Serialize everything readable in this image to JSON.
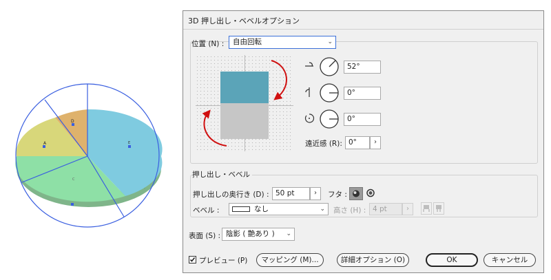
{
  "dialog": {
    "title": "3D 押し出し・ベベルオプション",
    "position_label": "位置 (N) :",
    "position_value": "自由回転",
    "rotation_x": "52°",
    "rotation_y": "0°",
    "rotation_z": "0°",
    "perspective_label": "遠近感 (R):",
    "perspective_value": "0°",
    "extrude_section_label": "押し出し・ベベル",
    "depth_label": "押し出しの奥行き (D) :",
    "depth_value": "50 pt",
    "cap_label": "フタ :",
    "bevel_label": "ベベル :",
    "bevel_value": "なし",
    "height_label": "高さ (H) :",
    "height_value": "4 pt",
    "surface_label": "表面 (S) :",
    "surface_value": "陰影 ( 艶あり )",
    "preview_label": "プレビュー (P)",
    "preview_checked": true,
    "mapping_button": "マッピング (M)...",
    "more_options_button": "詳細オプション (O)",
    "ok_button": "OK",
    "cancel_button": "キャンセル"
  },
  "pie": {
    "labels": [
      "A",
      "D",
      "C",
      "E"
    ],
    "colors": {
      "blue": "#7fcbe0",
      "green": "#8ee0a6",
      "yellow": "#d8d77a",
      "orange": "#dfb26c",
      "side": "#7fb58a",
      "outline": "#3a5fe0"
    }
  },
  "colors": {
    "accent": "#3a5fe0",
    "cube_front": "#5ba4b8",
    "cube_bottom": "#c6c6c6",
    "arrow": "#d01010"
  },
  "icons": [
    "x-axis-rotate-icon",
    "y-axis-rotate-icon",
    "z-axis-rotate-icon",
    "chevron-down-icon",
    "checkbox-icon",
    "cap-on-icon",
    "cap-off-icon",
    "bevel-out-icon",
    "bevel-in-icon"
  ]
}
